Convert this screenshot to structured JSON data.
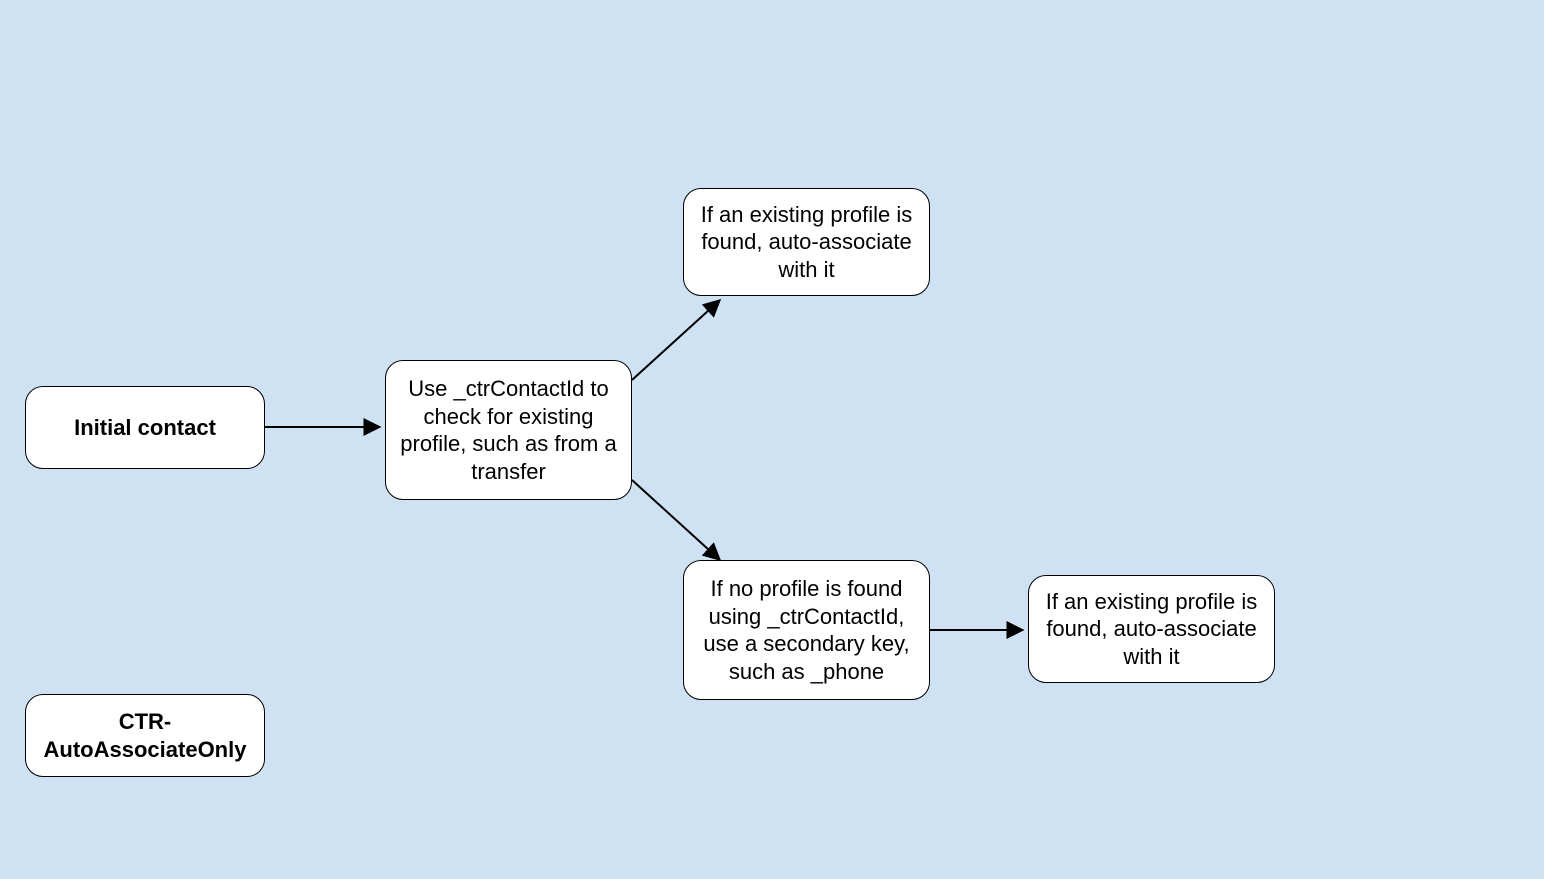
{
  "nodes": {
    "initial_contact": {
      "label": "Initial contact"
    },
    "check_profile": {
      "label": "Use _ctrContactId to check for existing profile, such as from a transfer"
    },
    "existing_found_top": {
      "label": "If an existing profile is found, auto-associate with it"
    },
    "no_profile": {
      "label": "If no profile is found using _ctrContactId, use a secondary key, such as _phone"
    },
    "existing_found_right": {
      "label": "If an existing profile is found, auto-associate with it"
    },
    "legend": {
      "label": "CTR-AutoAssociateOnly"
    }
  }
}
